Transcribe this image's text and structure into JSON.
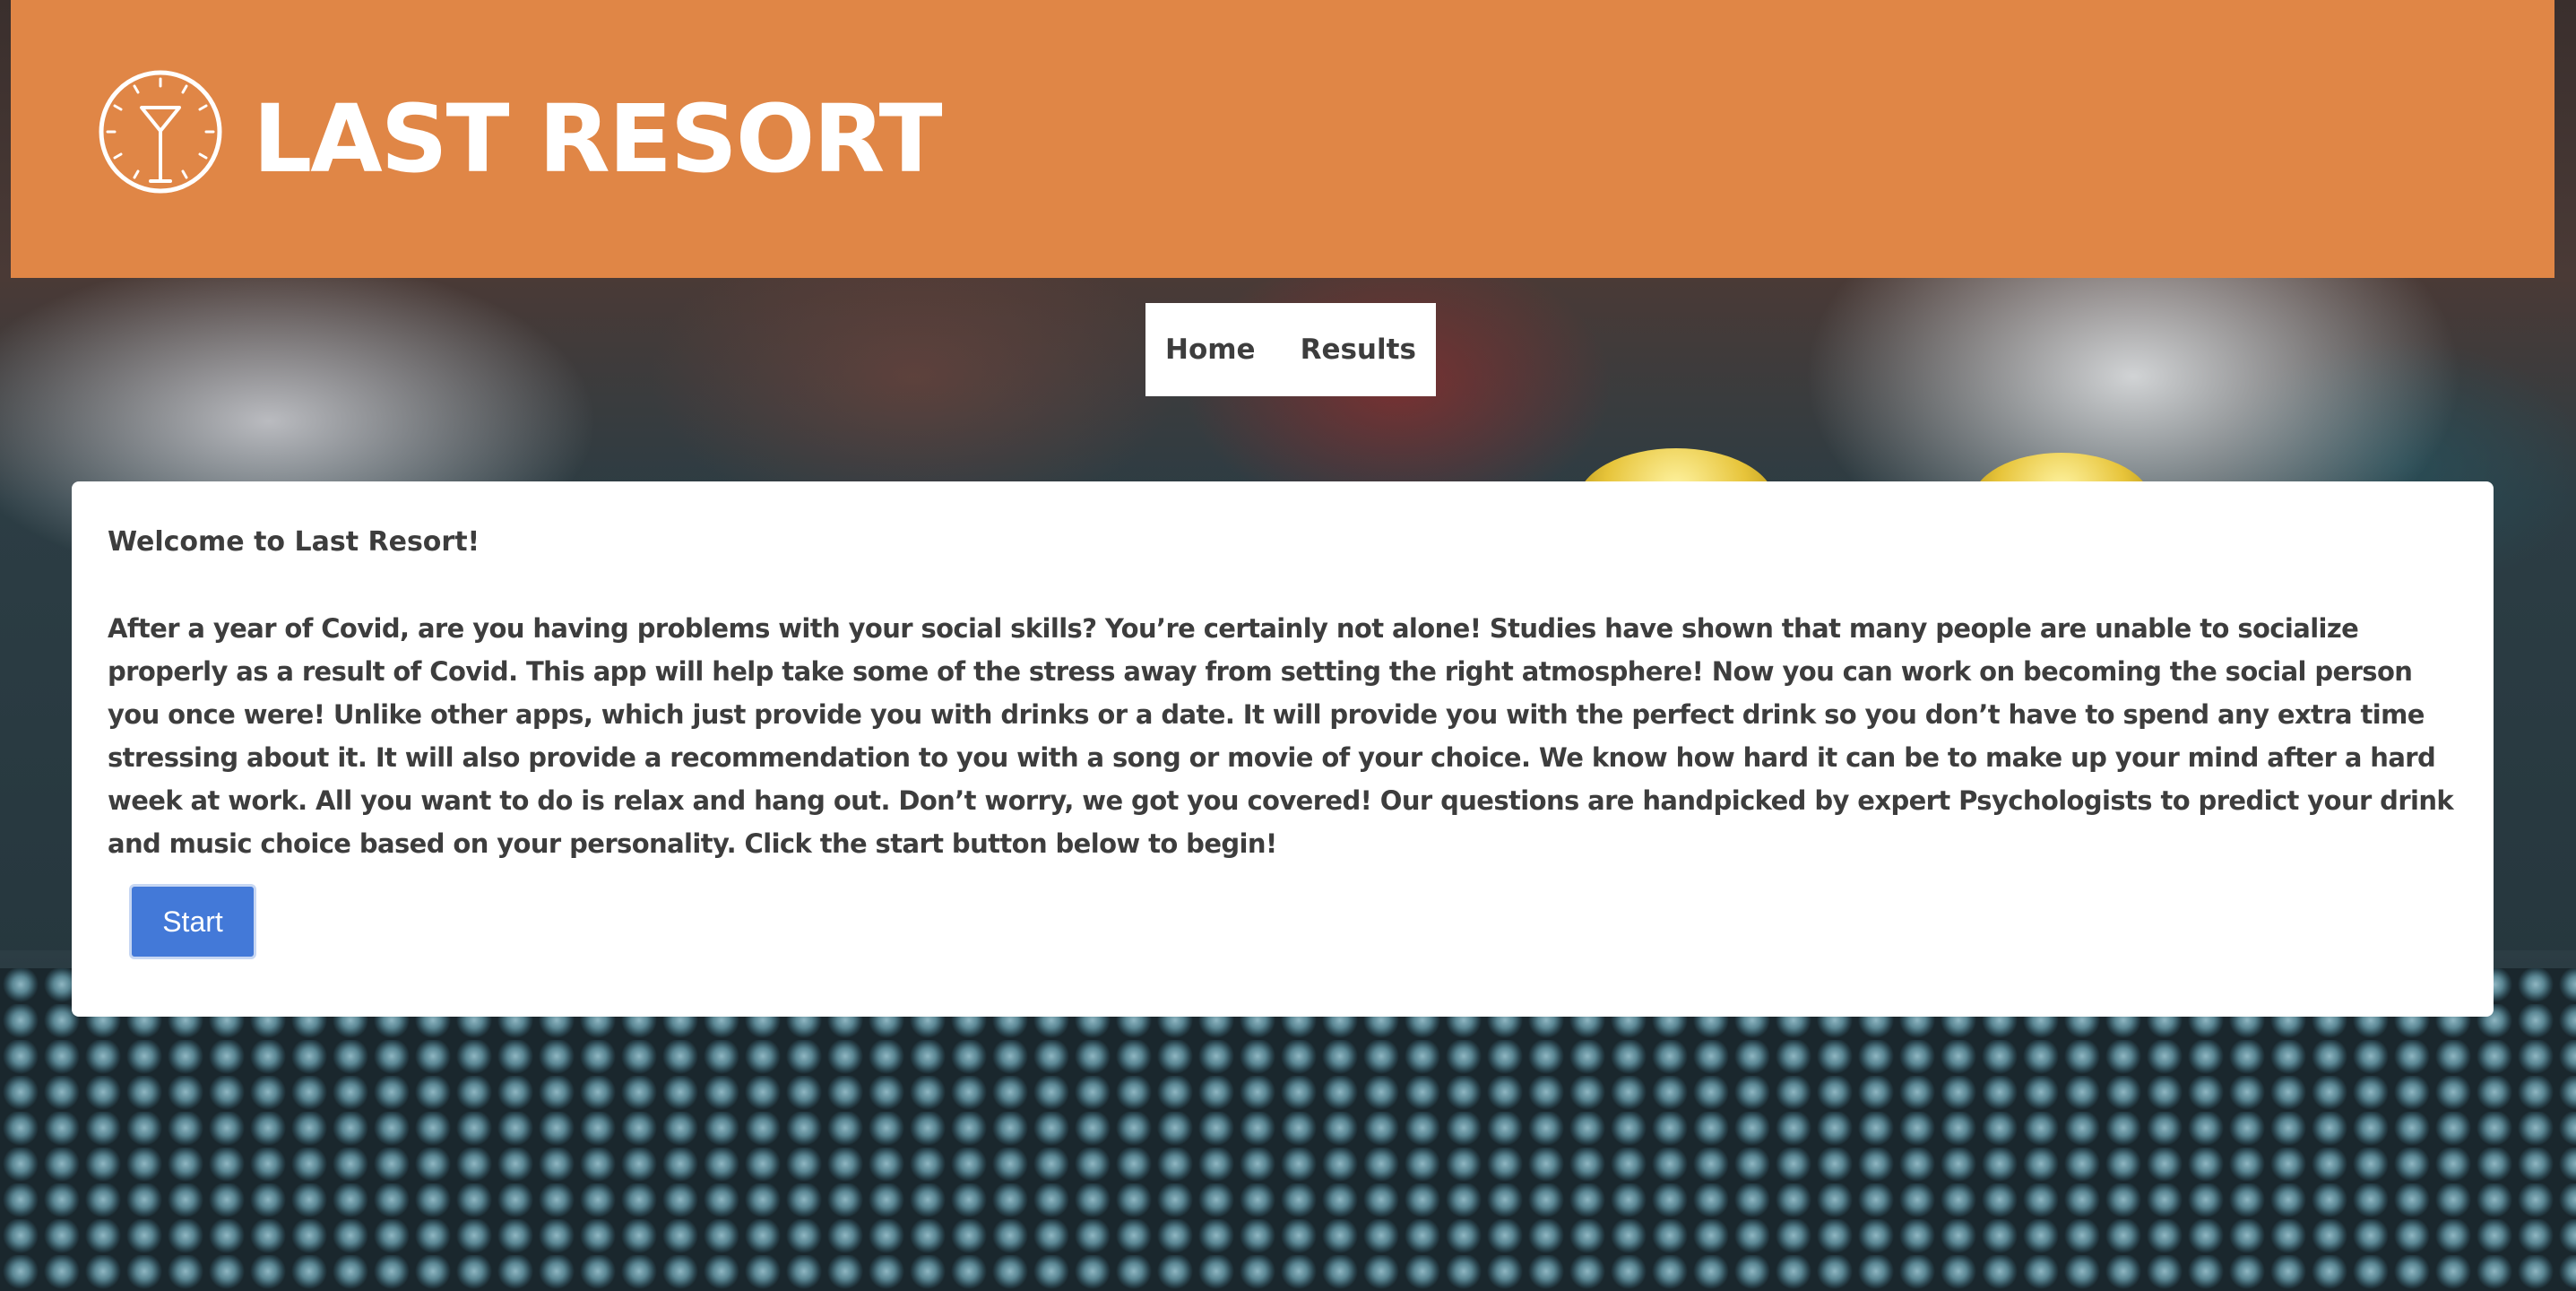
{
  "header": {
    "logo_icon": "cocktail-clock-icon",
    "title": "LAST RESORT",
    "color": "#e08646"
  },
  "nav": {
    "items": [
      {
        "label": "Home"
      },
      {
        "label": "Results"
      }
    ]
  },
  "main": {
    "welcome": "Welcome to Last Resort!",
    "intro": "After a year of Covid, are you having problems with your social skills? You’re certainly not alone! Studies have shown that many people are unable to socialize properly as a result of Covid. This app will help take some of the stress away from setting the right atmosphere! Now you can work on becoming the social person you once were! Unlike other apps, which just provide you with drinks or a date. It will provide you with the perfect drink so you don’t have to spend any extra time stressing about it. It will also provide a recommendation to you with a song or movie of your choice. We know how hard it can be to make up your mind after a hard week at work. All you want to do is relax and hang out. Don’t worry, we got you covered! Our questions are handpicked by expert Psychologists to predict your drink and music choice based on your personality. Click the start button below to begin!",
    "start_label": "Start",
    "button_color": "#4379d8"
  }
}
